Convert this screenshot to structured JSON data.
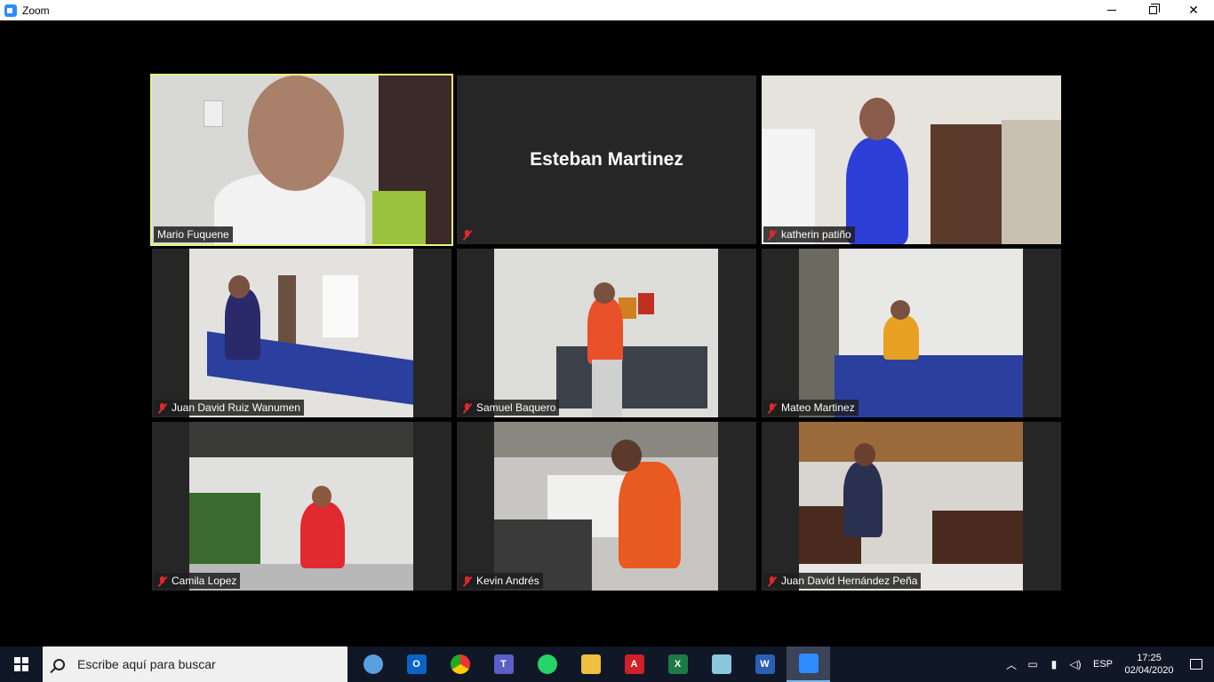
{
  "window": {
    "title": "Zoom",
    "controls": {
      "minimize_icon": "minimize-icon",
      "restore_icon": "restore-icon",
      "close_label": "✕"
    }
  },
  "participants": [
    {
      "name": "Mario Fuquene",
      "video": true,
      "active_speaker": true,
      "muted": false
    },
    {
      "name": "Esteban Martinez",
      "video": false,
      "active_speaker": false,
      "muted": true
    },
    {
      "name": "katherin patiño",
      "video": true,
      "active_speaker": false,
      "muted": true
    },
    {
      "name": "Juan David Ruiz Wanumen",
      "video": true,
      "active_speaker": false,
      "muted": true
    },
    {
      "name": "Samuel Baquero",
      "video": true,
      "active_speaker": false,
      "muted": true
    },
    {
      "name": "Mateo Martinez",
      "video": true,
      "active_speaker": false,
      "muted": true
    },
    {
      "name": "Camila Lopez",
      "video": true,
      "active_speaker": false,
      "muted": true
    },
    {
      "name": "Kevin Andrés",
      "video": true,
      "active_speaker": false,
      "muted": true
    },
    {
      "name": "Juan David Hernández Peña",
      "video": true,
      "active_speaker": false,
      "muted": true
    }
  ],
  "taskbar": {
    "search_placeholder": "Escribe aquí para buscar",
    "apps": [
      {
        "name": "cortana-icon"
      },
      {
        "name": "outlook-icon"
      },
      {
        "name": "chrome-icon"
      },
      {
        "name": "teams-icon"
      },
      {
        "name": "whatsapp-icon"
      },
      {
        "name": "file-explorer-icon"
      },
      {
        "name": "acrobat-icon"
      },
      {
        "name": "excel-icon"
      },
      {
        "name": "notes-icon"
      },
      {
        "name": "word-icon"
      },
      {
        "name": "zoom-icon"
      }
    ],
    "language": "ESP",
    "time": "17:25",
    "date": "02/04/2020"
  },
  "colors": {
    "active_speaker_border": "#e8f47a",
    "muted_icon": "#e02828",
    "taskbar_bg": "#101827"
  }
}
